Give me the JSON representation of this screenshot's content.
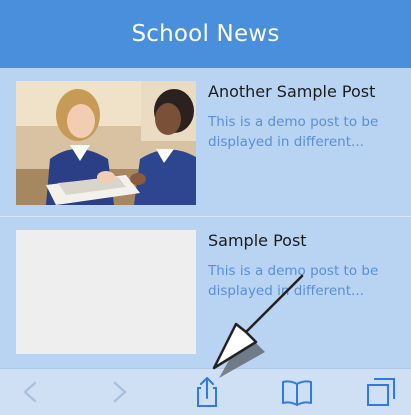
{
  "header": {
    "title": "School News"
  },
  "posts": [
    {
      "title": "Another Sample Post",
      "excerpt": "This is a demo post to be displayed in different...",
      "thumbnail": "photo-students-classroom"
    },
    {
      "title": "Sample Post",
      "excerpt": "This is a demo post to be displayed in different...",
      "thumbnail": "placeholder-blank"
    }
  ],
  "toolbar": {
    "icons": [
      "back-icon",
      "forward-icon",
      "share-icon",
      "bookmarks-icon",
      "tabs-icon"
    ]
  },
  "colors": {
    "header": "#4a8fdc",
    "background": "#b9d3f2",
    "excerpt": "#5b8fd5",
    "toolbar_icon": "#2f7ae5"
  }
}
